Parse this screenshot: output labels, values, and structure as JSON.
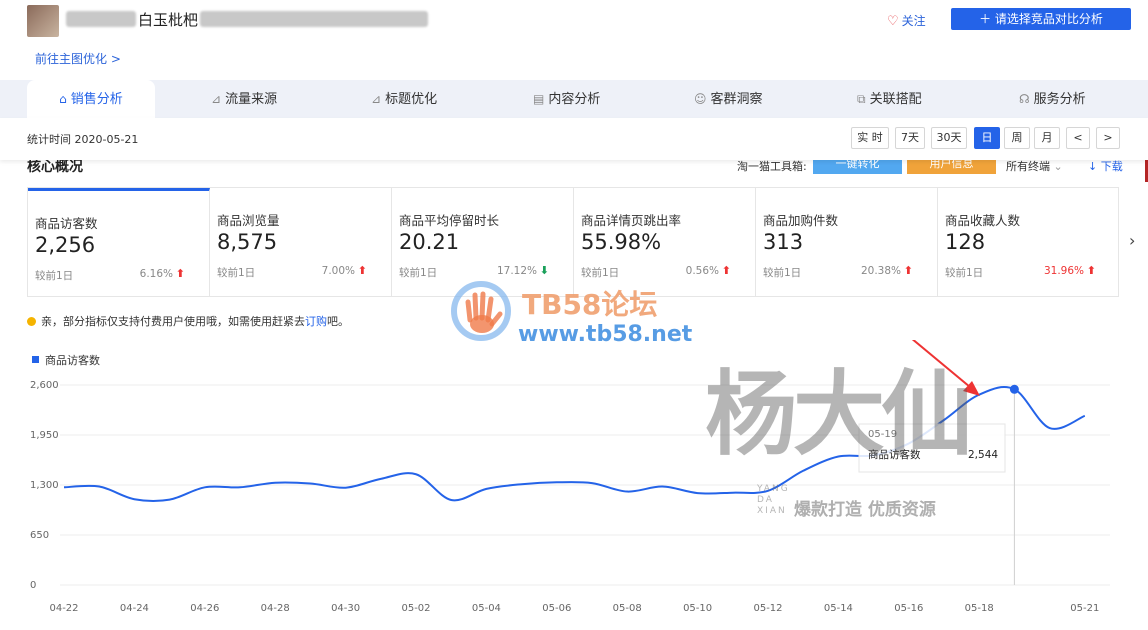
{
  "header": {
    "product_title": "白玉枇杷",
    "link_optimize": "前往主图优化 >",
    "follow_label": "关注",
    "compare_button": "＋ 请选择竞品对比分析"
  },
  "tabs": [
    {
      "label": "销售分析",
      "icon": "shop-icon"
    },
    {
      "label": "流量来源",
      "icon": "line-chart-icon"
    },
    {
      "label": "标题优化",
      "icon": "line-chart-icon"
    },
    {
      "label": "内容分析",
      "icon": "document-icon"
    },
    {
      "label": "客群洞察",
      "icon": "users-icon"
    },
    {
      "label": "关联搭配",
      "icon": "link-icon"
    },
    {
      "label": "服务分析",
      "icon": "headset-icon"
    }
  ],
  "timebar": {
    "stat_time": "统计时间 2020-05-21",
    "buttons": [
      "实 时",
      "7天",
      "30天",
      "日",
      "周",
      "月",
      "<",
      ">"
    ],
    "selected": "日"
  },
  "core": {
    "title": "核心概况",
    "tool_label": "淘一猫工具箱:",
    "tool_btn_1": "一键转化",
    "tool_btn_2": "用户信息",
    "terminal": "所有终端",
    "download": "↓ 下载",
    "colors": {
      "tool1": "#52a8f0",
      "tool2": "#f0a33a"
    }
  },
  "metrics": [
    {
      "label": "商品访客数",
      "value": "2,256",
      "compare": "较前1日",
      "pct": "6.16%",
      "dir": "up"
    },
    {
      "label": "商品浏览量",
      "value": "8,575",
      "compare": "较前1日",
      "pct": "7.00%",
      "dir": "up"
    },
    {
      "label": "商品平均停留时长",
      "value": "20.21",
      "compare": "较前1日",
      "pct": "17.12%",
      "dir": "down"
    },
    {
      "label": "商品详情页跳出率",
      "value": "55.98%",
      "compare": "较前1日",
      "pct": "0.56%",
      "dir": "up"
    },
    {
      "label": "商品加购件数",
      "value": "313",
      "compare": "较前1日",
      "pct": "20.38%",
      "dir": "up"
    },
    {
      "label": "商品收藏人数",
      "value": "128",
      "compare": "较前1日",
      "pct": "31.96%",
      "dir": "up"
    }
  ],
  "notice": {
    "text": "亲，部分指标仅支持付费用户使用哦，如需使用赶紧去",
    "link": "订购",
    "tail": "吧。"
  },
  "watermark": {
    "title": "TB58论坛",
    "url": "www.tb58.net",
    "brand": "杨大仙",
    "brand_en_1": "YANG",
    "brand_en_2": "DA",
    "brand_en_3": "XIAN",
    "slogan": "爆款打造 优质资源"
  },
  "chart_data": {
    "type": "line",
    "legend": "商品访客数",
    "series_color": "#2463e8",
    "ylim": [
      0,
      2600
    ],
    "yticks": [
      "2,600",
      "1,950",
      "1,300",
      "650",
      "0"
    ],
    "ytick_values": [
      2600,
      1950,
      1300,
      650,
      0
    ],
    "xtick_labels": [
      "04-22",
      "04-24",
      "04-26",
      "04-28",
      "04-30",
      "05-02",
      "05-04",
      "05-06",
      "05-08",
      "05-10",
      "05-12",
      "05-14",
      "05-16",
      "05-18",
      "05-21"
    ],
    "xtick_days": [
      0,
      2,
      4,
      6,
      8,
      10,
      12,
      14,
      16,
      18,
      20,
      22,
      24,
      26,
      29
    ],
    "x": [
      "04-22",
      "04-23",
      "04-24",
      "04-25",
      "04-26",
      "04-27",
      "04-28",
      "04-29",
      "04-30",
      "05-01",
      "05-02",
      "05-03",
      "05-04",
      "05-05",
      "05-06",
      "05-07",
      "05-08",
      "05-09",
      "05-10",
      "05-11",
      "05-12",
      "05-13",
      "05-14",
      "05-15",
      "05-16",
      "05-17",
      "05-18",
      "05-19",
      "05-20",
      "05-21"
    ],
    "values": [
      1270,
      1280,
      1115,
      1110,
      1270,
      1270,
      1330,
      1320,
      1265,
      1380,
      1440,
      1105,
      1250,
      1310,
      1335,
      1325,
      1215,
      1280,
      1195,
      1200,
      1225,
      1485,
      1670,
      1685,
      1840,
      2145,
      2475,
      2544,
      2040,
      2200
    ],
    "tooltip": {
      "date": "05-19",
      "series": "商品访客数",
      "value": "2,544"
    }
  }
}
